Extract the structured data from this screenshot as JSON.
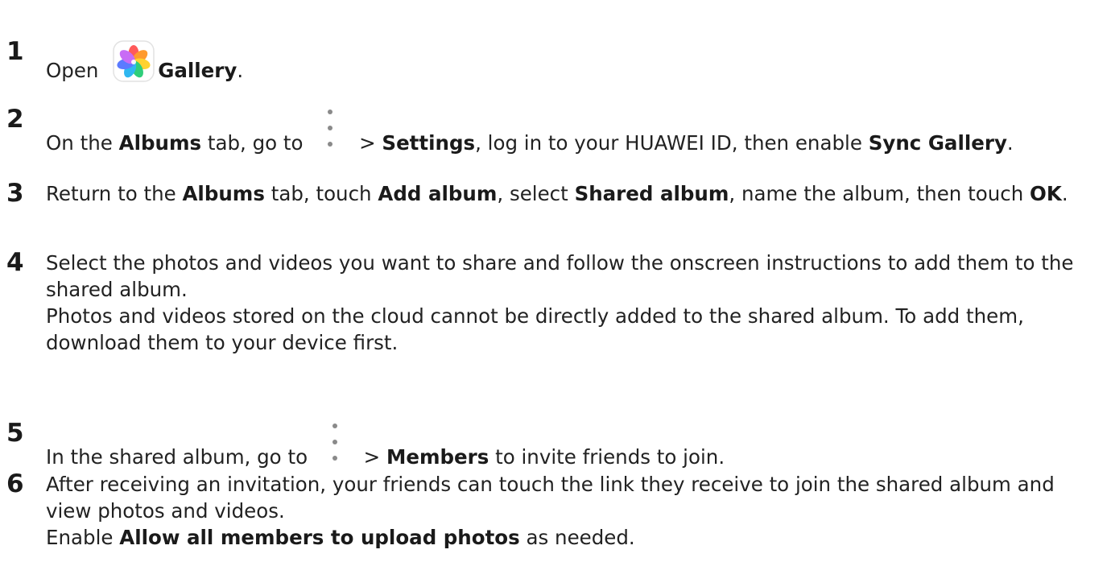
{
  "steps": [
    {
      "number": "1",
      "before": "Open ",
      "icon": "gallery-app-icon",
      "bold": "Gallery",
      "after": "."
    },
    {
      "number": "2",
      "t1": "On the ",
      "b1": "Albums",
      "t2": " tab, go to ",
      "icon": "more-vertical-icon",
      "t3": " > ",
      "b2": "Settings",
      "t4": ", log in to your HUAWEI ID, then enable ",
      "b3": "Sync Gallery",
      "t5": "."
    },
    {
      "number": "3",
      "t1": "Return to the ",
      "b1": "Albums",
      "t2": " tab, touch ",
      "b2": "Add album",
      "t3": ", select ",
      "b3": "Shared album",
      "t4": ", name the album, then touch ",
      "b4": "OK",
      "t5": "."
    },
    {
      "number": "4",
      "p1": "Select the photos and videos you want to share and follow the onscreen instructions to add them to the shared album.",
      "p2": "Photos and videos stored on the cloud cannot be directly added to the shared album. To add them, download them to your device first."
    },
    {
      "number": "5",
      "t1": "In the shared album, go to ",
      "icon": "more-vertical-icon",
      "t2": " > ",
      "b1": "Members",
      "t3": " to invite friends to join."
    },
    {
      "number": "6",
      "p1": "After receiving an invitation, your friends can touch the link they receive to join the shared album and view photos and videos.",
      "p2_t1": "Enable ",
      "p2_b1": "Allow all members to upload photos",
      "p2_t2": " as needed."
    }
  ]
}
